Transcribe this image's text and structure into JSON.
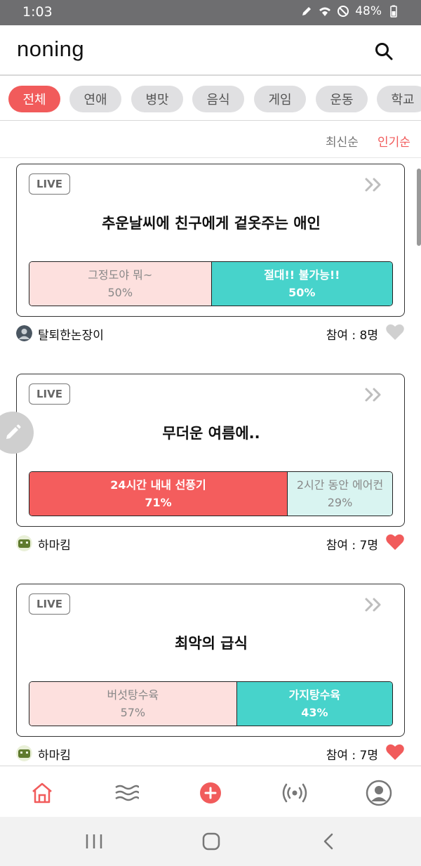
{
  "status_bar": {
    "time": "1:03",
    "battery": "48%"
  },
  "app": {
    "logo": "noning"
  },
  "categories": [
    "전체",
    "연애",
    "병맛",
    "음식",
    "게임",
    "운동",
    "학교"
  ],
  "sort": {
    "latest": "최신순",
    "popular": "인기순"
  },
  "posts": [
    {
      "badge": "LIVE",
      "title": "추운날씨에 친구에게 겉옷주는 애인",
      "options": [
        {
          "label": "그정도야 뭐~",
          "percent": "50%",
          "value": 50,
          "state": "lose",
          "color": "#fde0de"
        },
        {
          "label": "절대!! 불가능!!",
          "percent": "50%",
          "value": 50,
          "state": "win",
          "color": "#47d3cb"
        }
      ],
      "author": "탈퇴한논장이",
      "participants": "참여 : 8명",
      "liked": false
    },
    {
      "badge": "LIVE",
      "title": "무더운 여름에..",
      "options": [
        {
          "label": "24시간 내내 선풍기",
          "percent": "71%",
          "value": 71,
          "state": "win",
          "color": "#f45d5d"
        },
        {
          "label": "2시간 동안 에어컨",
          "percent": "29%",
          "value": 29,
          "state": "lose",
          "color": "#d9f4f1"
        }
      ],
      "author": "하마킴",
      "participants": "참여 : 7명",
      "liked": true
    },
    {
      "badge": "LIVE",
      "title": "최악의 급식",
      "options": [
        {
          "label": "버섯탕수육",
          "percent": "57%",
          "value": 57,
          "state": "lose",
          "color": "#fde0de"
        },
        {
          "label": "가지탕수육",
          "percent": "43%",
          "value": 43,
          "state": "win",
          "color": "#47d3cb"
        }
      ],
      "author": "하마킴",
      "participants": "참여 : 7명",
      "liked": true
    }
  ],
  "bottom_nav": [
    "home-icon",
    "waves-icon",
    "add-icon",
    "broadcast-icon",
    "profile-icon"
  ],
  "colors": {
    "accent": "#f15b5b",
    "teal": "#47d3cb",
    "pink": "#fde0de"
  }
}
